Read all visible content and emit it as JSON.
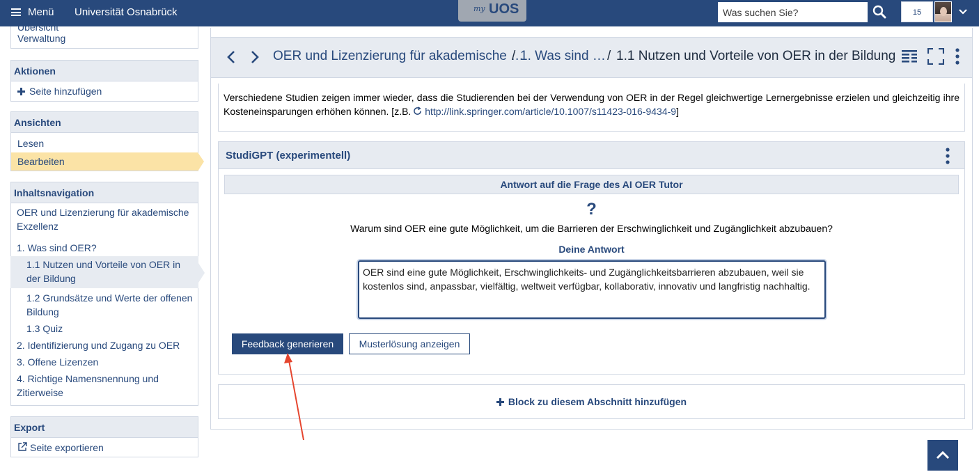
{
  "topbar": {
    "menu_label": "Menü",
    "university": "Universität Osnabrück",
    "logo_my": "my",
    "logo_uos": "UOS",
    "search_placeholder": "Was suchen Sie?",
    "notifications_count": "15"
  },
  "sidebar": {
    "partial_item": "Übersicht",
    "verwaltung": "Verwaltung",
    "aktionen": {
      "title": "Aktionen",
      "add_page": "Seite hinzufügen"
    },
    "ansichten": {
      "title": "Ansichten",
      "read": "Lesen",
      "edit": "Bearbeiten"
    },
    "inhaltsnavigation": {
      "title": "Inhaltsnavigation",
      "root": "OER und Lizenzierung für akademische Exzellenz",
      "items": [
        "1. Was sind OER?",
        "1.1 Nutzen und Vorteile von OER in der Bildung",
        "1.2 Grundsätze und Werte der offenen Bildung",
        "1.3 Quiz",
        "2. Identifizierung und Zugang zu OER",
        "3. Offene Lizenzen",
        "4. Richtige Namensnennung und Zitierweise"
      ]
    },
    "export": {
      "title": "Export",
      "export_page": "Seite exportieren"
    }
  },
  "header": {
    "crumb_1": "OER und Lizenzierung für akademische …",
    "sep_1": "/",
    "crumb_2": "1. Was sind …",
    "sep_2": "/",
    "current": "1.1 Nutzen und Vorteile von OER in der Bildung"
  },
  "textblock": {
    "text": "Verschiedene Studien zeigen immer wieder, dass die Studierenden bei der Verwendung von OER in der Regel gleichwertige Lernergebnisse erzielen und gleichzeitig ihre Kosteneinsparungen erhöhen können. [z.B. ",
    "link": "http://link.springer.com/article/10.1007/s11423-016-9434-9",
    "close": "]"
  },
  "studigpt": {
    "title": "StudiGPT (experimentell)",
    "question_header": "Antwort auf die Frage des AI OER Tutor",
    "question_mark": "?",
    "question": "Warum sind OER eine gute Möglichkeit, um die Barrieren der Erschwinglichkeit und Zugänglichkeit abzubauen?",
    "answer_label": "Deine Antwort",
    "answer_value": "OER sind eine gute Möglichkeit, Erschwinglichkeits- und Zugänglichkeitsbarrieren abzubauen, weil sie kostenlos sind, anpassbar, vielfältig, weltweit verfügbar, kollaborativ, innovativ und langfristig nachhaltig.",
    "feedback_button": "Feedback generieren",
    "solution_button": "Musterlösung anzeigen"
  },
  "add_block": "Block zu diesem Abschnitt hinzufügen",
  "colors": {
    "primary": "#28497c",
    "header_bg": "#e7ebf1",
    "active_bg": "#fbe3a6",
    "annotation_arrow": "#e5452e"
  }
}
